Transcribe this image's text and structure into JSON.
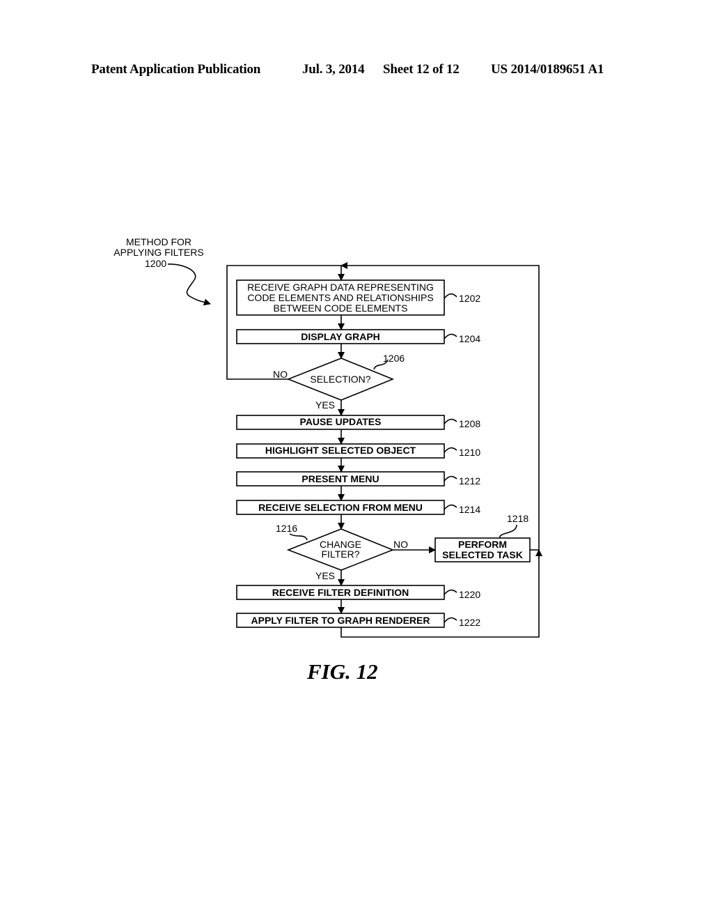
{
  "header": {
    "publication": "Patent Application Publication",
    "date": "Jul. 3, 2014",
    "sheet": "Sheet 12 of 12",
    "number": "US 2014/0189651 A1"
  },
  "method_label": {
    "line1": "METHOD FOR",
    "line2": "APPLYING FILTERS",
    "ref": "1200"
  },
  "steps": {
    "s1202": {
      "lines": [
        "RECEIVE GRAPH DATA REPRESENTING",
        "CODE ELEMENTS AND RELATIONSHIPS",
        "BETWEEN CODE ELEMENTS"
      ],
      "ref": "1202"
    },
    "s1204": {
      "label": "DISPLAY GRAPH",
      "ref": "1204"
    },
    "d1206": {
      "label": "SELECTION?",
      "ref": "1206",
      "no": "NO",
      "yes": "YES"
    },
    "s1208": {
      "label": "PAUSE UPDATES",
      "ref": "1208"
    },
    "s1210": {
      "label": "HIGHLIGHT SELECTED OBJECT",
      "ref": "1210"
    },
    "s1212": {
      "label": "PRESENT MENU",
      "ref": "1212"
    },
    "s1214": {
      "label": "RECEIVE SELECTION FROM MENU",
      "ref": "1214"
    },
    "d1216": {
      "lines": [
        "CHANGE",
        "FILTER?"
      ],
      "ref": "1216",
      "no": "NO",
      "yes": "YES"
    },
    "s1218": {
      "lines": [
        "PERFORM",
        "SELECTED TASK"
      ],
      "ref": "1218"
    },
    "s1220": {
      "label": "RECEIVE FILTER DEFINITION",
      "ref": "1220"
    },
    "s1222": {
      "label": "APPLY FILTER TO GRAPH RENDERER",
      "ref": "1222"
    }
  },
  "figure_caption": "FIG. 12"
}
